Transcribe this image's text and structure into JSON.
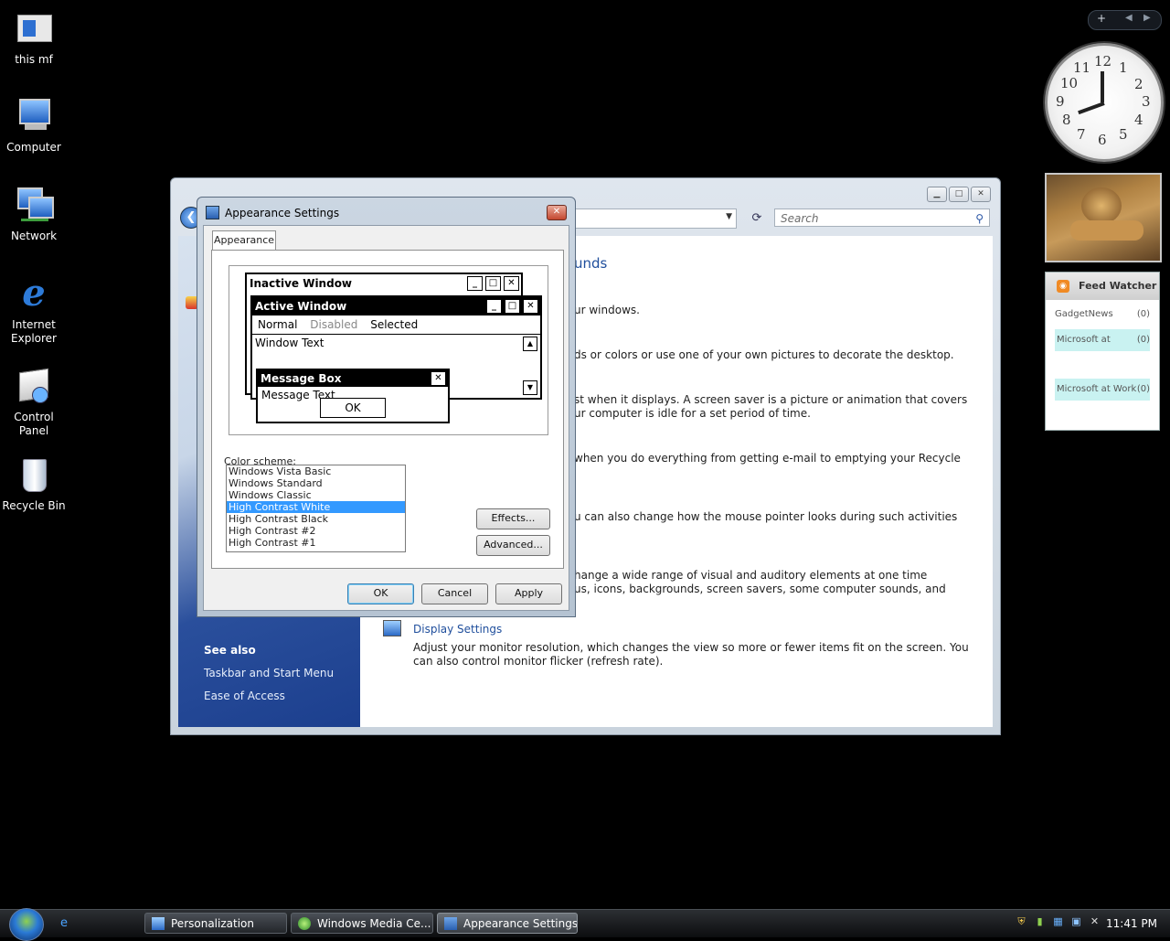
{
  "desktop": {
    "icons": [
      {
        "label": "this mf",
        "icon": "folder-icon"
      },
      {
        "label": "Computer",
        "icon": "computer-icon"
      },
      {
        "label": "Network",
        "icon": "network-icon"
      },
      {
        "label": "Internet Explorer",
        "icon": "internet-explorer-icon"
      },
      {
        "label": "Control Panel",
        "icon": "control-panel-icon"
      },
      {
        "label": "Recycle Bin",
        "icon": "recycle-bin-icon"
      }
    ]
  },
  "personalization_window": {
    "search_placeholder": "Search",
    "heading_fragment": "unds",
    "items": [
      {
        "desc": "ur windows."
      },
      {
        "desc": "ds or colors or use one of your own pictures to decorate the desktop."
      },
      {
        "desc_line1": "st when it displays. A screen saver is a picture or animation that covers",
        "desc_line2": "ur computer is idle for a set period of time."
      },
      {
        "desc": "when you do everything from getting e-mail to emptying your Recycle"
      },
      {
        "desc": "u can also change how the mouse pointer looks during such activities"
      },
      {
        "desc_line1": "hange a wide range of visual and auditory elements at one time",
        "desc_line2": "us, icons, backgrounds, screen savers, some computer sounds, and"
      }
    ],
    "display_settings": {
      "title": "Display Settings",
      "desc_line1": "Adjust your monitor resolution, which changes the view so more or fewer items fit on the screen. You",
      "desc_line2": "can also control monitor flicker (refresh rate)."
    },
    "see_also": {
      "heading": "See also",
      "links": [
        "Taskbar and Start Menu",
        "Ease of Access"
      ]
    }
  },
  "appearance_dialog": {
    "title": "Appearance Settings",
    "tab": "Appearance",
    "preview": {
      "inactive_title": "Inactive Window",
      "active_title": "Active Window",
      "menu_normal": "Normal",
      "menu_disabled": "Disabled",
      "menu_selected": "Selected",
      "window_text": "Window Text",
      "msgbox_title": "Message Box",
      "msgbox_text": "Message Text",
      "msgbox_ok": "OK"
    },
    "color_scheme_label": "Color scheme:",
    "color_schemes": [
      "Windows Vista Basic",
      "Windows Standard",
      "Windows Classic",
      "High Contrast White",
      "High Contrast Black",
      "High Contrast #2",
      "High Contrast #1"
    ],
    "selected_scheme": "High Contrast White",
    "effects_button": "Effects...",
    "advanced_button": "Advanced...",
    "ok_button": "OK",
    "cancel_button": "Cancel",
    "apply_button": "Apply"
  },
  "sidebar": {
    "clock_numbers": [
      "12",
      "1",
      "2",
      "3",
      "4",
      "5",
      "6",
      "7",
      "8",
      "9",
      "10",
      "11"
    ],
    "feed_watcher": {
      "title": "Feed Watcher",
      "feeds": [
        {
          "name": "GadgetNews",
          "count": "(0)"
        },
        {
          "name": "Microsoft at",
          "count": "(0)"
        },
        {
          "name": "Microsoft at Work",
          "count": "(0)"
        }
      ]
    }
  },
  "taskbar": {
    "tasks": [
      {
        "label": "Personalization"
      },
      {
        "label": "Windows Media Ce..."
      },
      {
        "label": "Appearance Settings"
      }
    ],
    "clock": "11:41 PM"
  },
  "colors": {
    "selection": "#3399ff",
    "link": "#1f4e9c",
    "feed_highlight": "#c9f2f1"
  }
}
